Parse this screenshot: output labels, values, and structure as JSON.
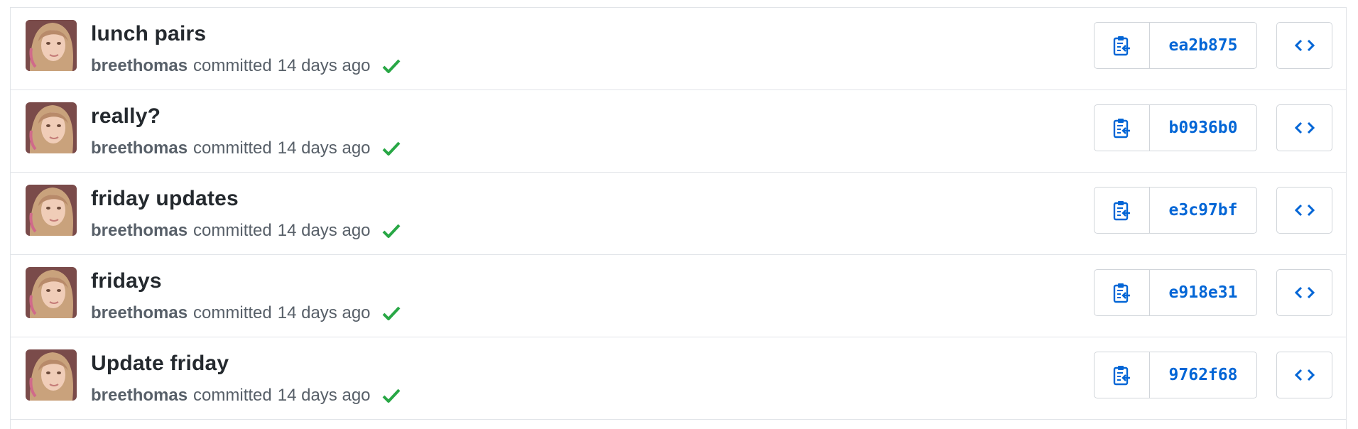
{
  "colors": {
    "accent": "#0366d6",
    "success": "#28a745",
    "text_primary": "#24292e",
    "text_muted": "#586069",
    "border": "#e1e4e8"
  },
  "icons": {
    "copy": "clippy-icon",
    "browse": "code-icon",
    "status": "check-icon"
  },
  "commits": [
    {
      "title": "lunch pairs",
      "author": "breethomas",
      "action": "committed",
      "time": "14 days ago",
      "sha": "ea2b875"
    },
    {
      "title": "really?",
      "author": "breethomas",
      "action": "committed",
      "time": "14 days ago",
      "sha": "b0936b0"
    },
    {
      "title": "friday updates",
      "author": "breethomas",
      "action": "committed",
      "time": "14 days ago",
      "sha": "e3c97bf"
    },
    {
      "title": "fridays",
      "author": "breethomas",
      "action": "committed",
      "time": "14 days ago",
      "sha": "e918e31"
    },
    {
      "title": "Update friday",
      "author": "breethomas",
      "action": "committed",
      "time": "14 days ago",
      "sha": "9762f68"
    }
  ]
}
